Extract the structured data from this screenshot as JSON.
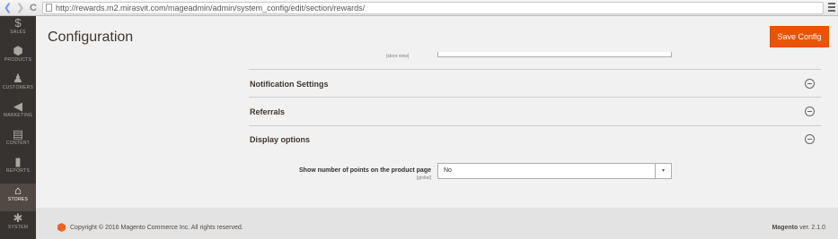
{
  "browser": {
    "url": "http://rewards.m2.mirasvit.com/mageadmin/admin/system_config/edit/section/rewards/"
  },
  "sidebar": {
    "items": [
      {
        "label": "SALES",
        "icon": "dollar-icon",
        "glyph": "$"
      },
      {
        "label": "PRODUCTS",
        "icon": "cube-icon",
        "glyph": "⬢"
      },
      {
        "label": "CUSTOMERS",
        "icon": "person-icon",
        "glyph": "♟"
      },
      {
        "label": "MARKETING",
        "icon": "megaphone-icon",
        "glyph": "◀"
      },
      {
        "label": "CONTENT",
        "icon": "content-icon",
        "glyph": "▤"
      },
      {
        "label": "REPORTS",
        "icon": "bar-chart-icon",
        "glyph": "▮"
      },
      {
        "label": "STORES",
        "icon": "store-icon",
        "glyph": "⌂"
      },
      {
        "label": "SYSTEM",
        "icon": "gear-icon",
        "glyph": "✱"
      }
    ]
  },
  "header": {
    "title": "Configuration",
    "save_label": "Save Config"
  },
  "content": {
    "store_view_label": "[store view]",
    "sections": [
      {
        "title": "Notification Settings"
      },
      {
        "title": "Referrals"
      },
      {
        "title": "Display options"
      }
    ],
    "display_options": {
      "field_label": "Show number of points on the product page",
      "scope": "[global]",
      "value": "No"
    }
  },
  "footer": {
    "copyright": "Copyright © 2016 Magento Commerce Inc. All rights reserved.",
    "brand": "Magento",
    "version": "ver. 2.1.0"
  },
  "colors": {
    "accent": "#eb5202",
    "sidebar_bg": "#373330",
    "sidebar_active": "#514943"
  }
}
